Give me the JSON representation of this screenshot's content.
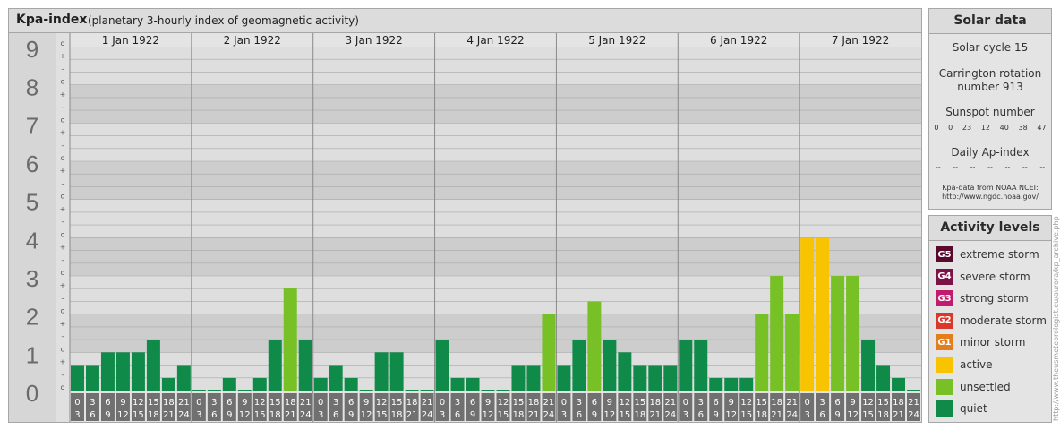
{
  "header": {
    "title": "Kpa-index",
    "subtitle": "(planetary 3-hourly index of geomagnetic activity)"
  },
  "chart_data": {
    "type": "bar",
    "ylim": [
      0,
      9
    ],
    "y_ticks": [
      "0",
      "1",
      "2",
      "3",
      "4",
      "5",
      "6",
      "7",
      "8",
      "9"
    ],
    "minor_tick_marks": [
      "+",
      "o",
      "-"
    ],
    "days": [
      "1 Jan 1922",
      "2 Jan 1922",
      "3 Jan 1922",
      "4 Jan 1922",
      "5 Jan 1922",
      "6 Jan 1922",
      "7 Jan 1922"
    ],
    "interval_starts": [
      "0",
      "3",
      "6",
      "9",
      "12",
      "15",
      "18",
      "21"
    ],
    "interval_ends": [
      "3",
      "6",
      "9",
      "12",
      "15",
      "18",
      "21",
      "24"
    ],
    "values": [
      0.67,
      0.67,
      1.0,
      1.0,
      1.0,
      1.33,
      0.33,
      0.67,
      0.0,
      0.0,
      0.33,
      0.0,
      0.33,
      1.33,
      2.67,
      1.33,
      0.33,
      0.67,
      0.33,
      0.0,
      1.0,
      1.0,
      0.0,
      0.0,
      1.33,
      0.33,
      0.33,
      0.0,
      0.0,
      0.67,
      0.67,
      2.0,
      0.67,
      1.33,
      2.33,
      1.33,
      1.0,
      0.67,
      0.67,
      0.67,
      1.33,
      1.33,
      0.33,
      0.33,
      0.33,
      2.0,
      3.0,
      2.0,
      4.0,
      4.0,
      3.0,
      3.0,
      1.33,
      0.67,
      0.33,
      0.0
    ],
    "bar_colors": {
      "quiet": "#0f8a48",
      "unsettled": "#77c026",
      "active": "#f8c300"
    },
    "band_colors": {
      "dark": "#cdcdcd",
      "light": "#dedede",
      "gridline": "#a8a8a8"
    }
  },
  "solar": {
    "title": "Solar data",
    "cycle": "Solar cycle 15",
    "carrington": "Carrington rotation number 913",
    "sunspot_title": "Sunspot number",
    "sunspot_values": [
      "0",
      "0",
      "23",
      "12",
      "40",
      "38",
      "47"
    ],
    "ap_title": "Daily Ap-index",
    "ap_values": [
      "--",
      "--",
      "--",
      "--",
      "--",
      "--",
      "--"
    ],
    "credit_line1": "Kpa-data from NOAA NCEI:",
    "credit_line2": "http://www.ngdc.noaa.gov/"
  },
  "activity": {
    "title": "Activity levels",
    "levels": [
      {
        "code": "G5",
        "label": "extreme storm",
        "color": "#5a0a2c"
      },
      {
        "code": "G4",
        "label": "severe storm",
        "color": "#7b1347"
      },
      {
        "code": "G3",
        "label": "strong storm",
        "color": "#c21a6d"
      },
      {
        "code": "G2",
        "label": "moderate storm",
        "color": "#d8392a"
      },
      {
        "code": "G1",
        "label": "minor storm",
        "color": "#e37e1f"
      },
      {
        "code": "",
        "label": "active",
        "color": "#f8c300"
      },
      {
        "code": "",
        "label": "unsettled",
        "color": "#77c026"
      },
      {
        "code": "",
        "label": "quiet",
        "color": "#0f8a48"
      }
    ]
  },
  "watermark": "http://www.theusmeteorologist.eu/aurora/kp_archive.php"
}
